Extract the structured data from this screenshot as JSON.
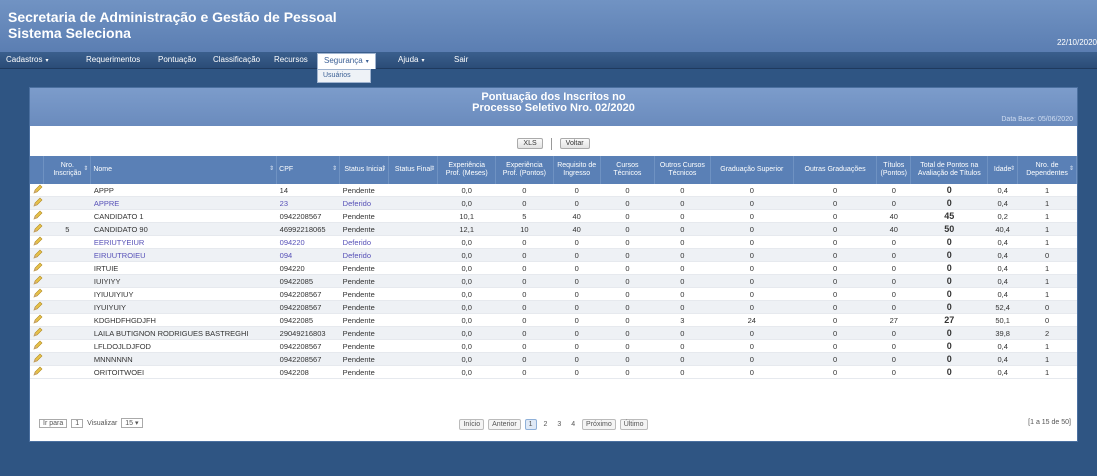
{
  "header": {
    "title_line1": "Secretaria de Administração e Gestão de Pessoal",
    "title_line2": "Sistema Seleciona",
    "date": "22/10/2020"
  },
  "menu": {
    "items": [
      {
        "label": "Cadastros",
        "arrow": "▾"
      },
      {
        "label": "Requerimentos",
        "arrow": ""
      },
      {
        "label": "Pontuação",
        "arrow": ""
      },
      {
        "label": "Classificação",
        "arrow": ""
      },
      {
        "label": "Recursos",
        "arrow": ""
      },
      {
        "label": "Segurança",
        "arrow": "▾"
      },
      {
        "label": "Ajuda",
        "arrow": "▾"
      },
      {
        "label": "Sair",
        "arrow": ""
      }
    ],
    "submenu_item": "Usuários"
  },
  "panel": {
    "title_line1": "Pontuação dos Inscritos no",
    "title_line2": "Processo Seletivo Nro. 02/2020",
    "database": "Data Base: 05/06/2020",
    "btn_xls": "XLS",
    "btn_back": "Voltar"
  },
  "columns": [
    "",
    "Nro. Inscrição",
    "Nome",
    "CPF",
    "Status Inicial",
    "Status Final",
    "Experiência Prof. (Meses)",
    "Experiência Prof. (Pontos)",
    "Requisito de Ingresso",
    "Cursos Técnicos",
    "Outros Cursos Técnicos",
    "Graduação Superior",
    "Outras Graduações",
    "Títulos (Pontos)",
    "Total de Pontos na Avaliação de Títulos",
    "Idade",
    "Nro. de Dependentes"
  ],
  "rows": [
    {
      "inscricao": "",
      "nome": "APPP",
      "cpf": "14",
      "status": "Pendente",
      "final": "",
      "exp_meses": "0,0",
      "exp_pontos": "0",
      "requisito": "0",
      "cursos": "0",
      "outros_cursos": "0",
      "graduacao": "0",
      "outras_grad": "0",
      "titulos": "0",
      "total": "0",
      "idade": "0,4",
      "dependentes": "1"
    },
    {
      "inscricao": "",
      "nome": "APPRE",
      "cpf": "23",
      "status": "Deferido",
      "final": "",
      "exp_meses": "0,0",
      "exp_pontos": "0",
      "requisito": "0",
      "cursos": "0",
      "outros_cursos": "0",
      "graduacao": "0",
      "outras_grad": "0",
      "titulos": "0",
      "total": "0",
      "idade": "0,4",
      "dependentes": "1"
    },
    {
      "inscricao": "",
      "nome": "CANDIDATO 1",
      "cpf": "0942208567",
      "status": "Pendente",
      "final": "",
      "exp_meses": "10,1",
      "exp_pontos": "5",
      "requisito": "40",
      "cursos": "0",
      "outros_cursos": "0",
      "graduacao": "0",
      "outras_grad": "0",
      "titulos": "40",
      "total": "45",
      "idade": "0,2",
      "dependentes": "1"
    },
    {
      "inscricao": "5",
      "nome": "CANDIDATO 90",
      "cpf": "46992218065",
      "status": "Pendente",
      "final": "",
      "exp_meses": "12,1",
      "exp_pontos": "10",
      "requisito": "40",
      "cursos": "0",
      "outros_cursos": "0",
      "graduacao": "0",
      "outras_grad": "0",
      "titulos": "40",
      "total": "50",
      "idade": "40,4",
      "dependentes": "1"
    },
    {
      "inscricao": "",
      "nome": "EERIUTYEIUR",
      "cpf": "094220",
      "status": "Deferido",
      "final": "",
      "exp_meses": "0,0",
      "exp_pontos": "0",
      "requisito": "0",
      "cursos": "0",
      "outros_cursos": "0",
      "graduacao": "0",
      "outras_grad": "0",
      "titulos": "0",
      "total": "0",
      "idade": "0,4",
      "dependentes": "1"
    },
    {
      "inscricao": "",
      "nome": "EIRUUTROIEU",
      "cpf": "094",
      "status": "Deferido",
      "final": "",
      "exp_meses": "0,0",
      "exp_pontos": "0",
      "requisito": "0",
      "cursos": "0",
      "outros_cursos": "0",
      "graduacao": "0",
      "outras_grad": "0",
      "titulos": "0",
      "total": "0",
      "idade": "0,4",
      "dependentes": "0"
    },
    {
      "inscricao": "",
      "nome": "IRTUIE",
      "cpf": "094220",
      "status": "Pendente",
      "final": "",
      "exp_meses": "0,0",
      "exp_pontos": "0",
      "requisito": "0",
      "cursos": "0",
      "outros_cursos": "0",
      "graduacao": "0",
      "outras_grad": "0",
      "titulos": "0",
      "total": "0",
      "idade": "0,4",
      "dependentes": "1"
    },
    {
      "inscricao": "",
      "nome": "IUIYIYY",
      "cpf": "09422085",
      "status": "Pendente",
      "final": "",
      "exp_meses": "0,0",
      "exp_pontos": "0",
      "requisito": "0",
      "cursos": "0",
      "outros_cursos": "0",
      "graduacao": "0",
      "outras_grad": "0",
      "titulos": "0",
      "total": "0",
      "idade": "0,4",
      "dependentes": "1"
    },
    {
      "inscricao": "",
      "nome": "IYIUUIYIUY",
      "cpf": "0942208567",
      "status": "Pendente",
      "final": "",
      "exp_meses": "0,0",
      "exp_pontos": "0",
      "requisito": "0",
      "cursos": "0",
      "outros_cursos": "0",
      "graduacao": "0",
      "outras_grad": "0",
      "titulos": "0",
      "total": "0",
      "idade": "0,4",
      "dependentes": "1"
    },
    {
      "inscricao": "",
      "nome": "IYUIYUIY",
      "cpf": "0942208567",
      "status": "Pendente",
      "final": "",
      "exp_meses": "0,0",
      "exp_pontos": "0",
      "requisito": "0",
      "cursos": "0",
      "outros_cursos": "0",
      "graduacao": "0",
      "outras_grad": "0",
      "titulos": "0",
      "total": "0",
      "idade": "52,4",
      "dependentes": "0"
    },
    {
      "inscricao": "",
      "nome": "KDGHDFHGDJFH",
      "cpf": "09422085",
      "status": "Pendente",
      "final": "",
      "exp_meses": "0,0",
      "exp_pontos": "0",
      "requisito": "0",
      "cursos": "0",
      "outros_cursos": "3",
      "graduacao": "24",
      "outras_grad": "0",
      "titulos": "27",
      "total": "27",
      "idade": "50,1",
      "dependentes": "0"
    },
    {
      "inscricao": "",
      "nome": "LAILA BUTIGNON RODRIGUES BASTREGHI",
      "cpf": "29049216803",
      "status": "Pendente",
      "final": "",
      "exp_meses": "0,0",
      "exp_pontos": "0",
      "requisito": "0",
      "cursos": "0",
      "outros_cursos": "0",
      "graduacao": "0",
      "outras_grad": "0",
      "titulos": "0",
      "total": "0",
      "idade": "39,8",
      "dependentes": "2"
    },
    {
      "inscricao": "",
      "nome": "LFLDOJLDJFOD",
      "cpf": "0942208567",
      "status": "Pendente",
      "final": "",
      "exp_meses": "0,0",
      "exp_pontos": "0",
      "requisito": "0",
      "cursos": "0",
      "outros_cursos": "0",
      "graduacao": "0",
      "outras_grad": "0",
      "titulos": "0",
      "total": "0",
      "idade": "0,4",
      "dependentes": "1"
    },
    {
      "inscricao": "",
      "nome": "MNNNNNN",
      "cpf": "0942208567",
      "status": "Pendente",
      "final": "",
      "exp_meses": "0,0",
      "exp_pontos": "0",
      "requisito": "0",
      "cursos": "0",
      "outros_cursos": "0",
      "graduacao": "0",
      "outras_grad": "0",
      "titulos": "0",
      "total": "0",
      "idade": "0,4",
      "dependentes": "1"
    },
    {
      "inscricao": "",
      "nome": "ORITOITWOEI",
      "cpf": "0942208",
      "status": "Pendente",
      "final": "",
      "exp_meses": "0,0",
      "exp_pontos": "0",
      "requisito": "0",
      "cursos": "0",
      "outros_cursos": "0",
      "graduacao": "0",
      "outras_grad": "0",
      "titulos": "0",
      "total": "0",
      "idade": "0,4",
      "dependentes": "1"
    }
  ],
  "footer": {
    "ir_para_label": "Ir para",
    "ir_para_value": "1",
    "visualizar_label": "Visualizar",
    "visualizar_value": "15 ▾",
    "pager": {
      "first": "Início",
      "prev": "Anterior",
      "pages": [
        "1",
        "2",
        "3",
        "4"
      ],
      "next": "Próximo",
      "last": "Último"
    },
    "range": "[1 a 15 de 50]"
  }
}
